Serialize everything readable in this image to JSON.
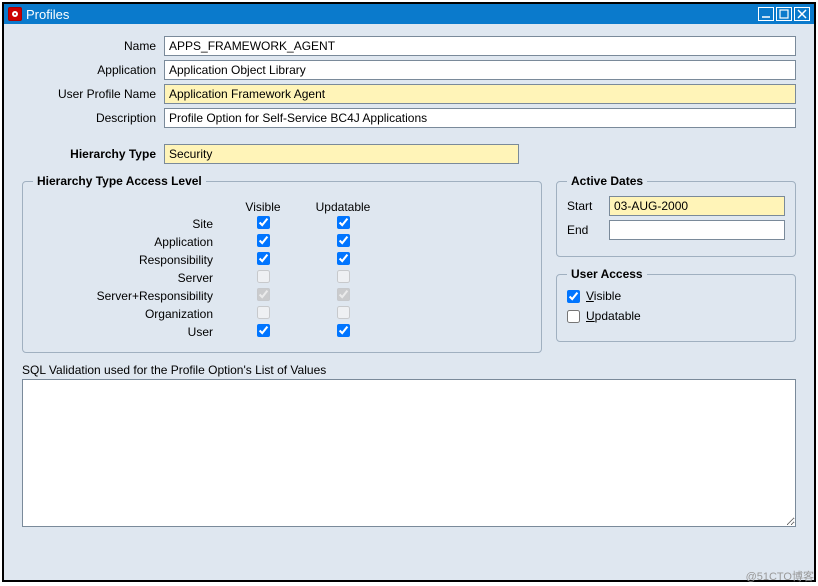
{
  "window": {
    "title": "Profiles"
  },
  "form": {
    "name_label": "Name",
    "name_value": "APPS_FRAMEWORK_AGENT",
    "application_label": "Application",
    "application_value": "Application Object Library",
    "user_profile_label": "User Profile Name",
    "user_profile_value": "Application Framework Agent",
    "description_label": "Description",
    "description_value": "Profile Option for Self-Service BC4J Applications",
    "hierarchy_type_label": "Hierarchy Type",
    "hierarchy_type_value": "Security"
  },
  "access_level": {
    "legend": "Hierarchy Type Access Level",
    "col_visible": "Visible",
    "col_updatable": "Updatable",
    "rows": [
      {
        "label": "Site",
        "visible": true,
        "updatable": true,
        "disabled": false
      },
      {
        "label": "Application",
        "visible": true,
        "updatable": true,
        "disabled": false
      },
      {
        "label": "Responsibility",
        "visible": true,
        "updatable": true,
        "disabled": false
      },
      {
        "label": "Server",
        "visible": false,
        "updatable": false,
        "disabled": true
      },
      {
        "label": "Server+Responsibility",
        "visible": true,
        "updatable": true,
        "disabled": true
      },
      {
        "label": "Organization",
        "visible": false,
        "updatable": false,
        "disabled": true
      },
      {
        "label": "User",
        "visible": true,
        "updatable": true,
        "disabled": false
      }
    ]
  },
  "active_dates": {
    "legend": "Active Dates",
    "start_label": "Start",
    "start_value": "03-AUG-2000",
    "end_label": "End",
    "end_value": ""
  },
  "user_access": {
    "legend": "User Access",
    "visible_label": "Visible",
    "visible_checked": true,
    "updatable_label": "Updatable",
    "updatable_checked": false
  },
  "sql": {
    "label": "SQL Validation used for the Profile Option's List of Values",
    "value": ""
  },
  "watermark": "@51CTO博客"
}
